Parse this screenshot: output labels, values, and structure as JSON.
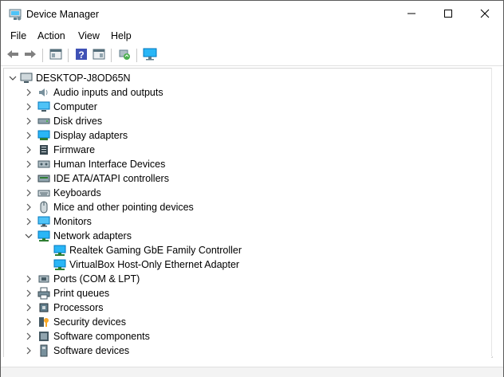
{
  "window": {
    "title": "Device Manager",
    "title_icon": "device-manager-icon",
    "controls": [
      "minimize-icon",
      "maximize-icon",
      "close-icon"
    ]
  },
  "menu": [
    "File",
    "Action",
    "View",
    "Help"
  ],
  "toolbar": {
    "buttons": [
      "back-arrow-icon",
      "forward-arrow-icon",
      "properties-icon",
      "help-icon",
      "update-driver-icon",
      "scan-hardware-icon",
      "monitor-icon"
    ]
  },
  "tree": {
    "root": "DESKTOP-J8OD65N",
    "categories": [
      {
        "label": "Audio inputs and outputs",
        "icon": "speaker-icon"
      },
      {
        "label": "Computer",
        "icon": "computer-icon"
      },
      {
        "label": "Disk drives",
        "icon": "disk-drive-icon"
      },
      {
        "label": "Display adapters",
        "icon": "display-adapter-icon"
      },
      {
        "label": "Firmware",
        "icon": "firmware-icon"
      },
      {
        "label": "Human Interface Devices",
        "icon": "hid-icon"
      },
      {
        "label": "IDE ATA/ATAPI controllers",
        "icon": "ide-controller-icon"
      },
      {
        "label": "Keyboards",
        "icon": "keyboard-icon"
      },
      {
        "label": "Mice and other pointing devices",
        "icon": "mouse-icon"
      },
      {
        "label": "Monitors",
        "icon": "monitor-icon"
      },
      {
        "label": "Network adapters",
        "icon": "network-adapter-icon",
        "expanded": true,
        "children": [
          "Realtek Gaming GbE Family Controller",
          "VirtualBox Host-Only Ethernet Adapter"
        ]
      },
      {
        "label": "Ports (COM & LPT)",
        "icon": "port-icon"
      },
      {
        "label": "Print queues",
        "icon": "printer-icon"
      },
      {
        "label": "Processors",
        "icon": "processor-icon"
      },
      {
        "label": "Security devices",
        "icon": "security-key-icon"
      },
      {
        "label": "Software components",
        "icon": "software-component-icon"
      },
      {
        "label": "Software devices",
        "icon": "software-device-icon"
      }
    ]
  },
  "colors": {
    "accent": "#1e88c7",
    "text": "#000000",
    "border": "#d6d6d6"
  }
}
